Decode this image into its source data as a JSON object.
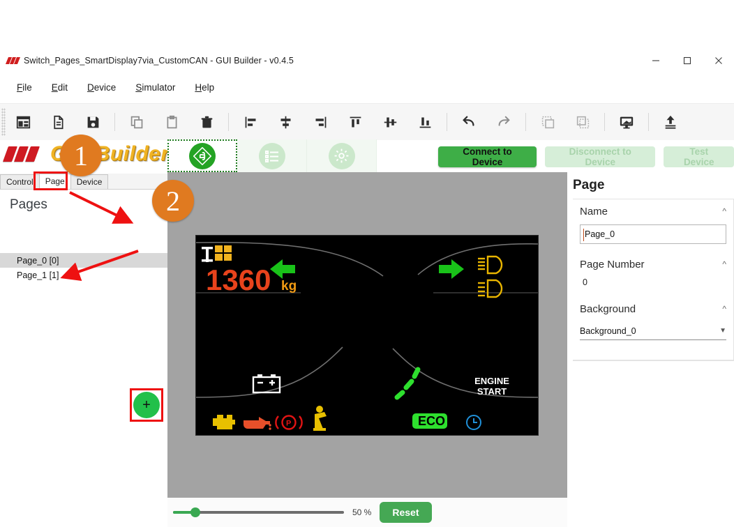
{
  "window": {
    "title": "Switch_Pages_SmartDisplay7via_CustomCAN - GUI Builder - v0.4.5",
    "minimize_label": "minimize",
    "maximize_label": "maximize",
    "close_label": "close"
  },
  "menubar": {
    "items": [
      {
        "label": "File",
        "accel": "F"
      },
      {
        "label": "Edit",
        "accel": "E"
      },
      {
        "label": "Device",
        "accel": "D"
      },
      {
        "label": "Simulator",
        "accel": "S"
      },
      {
        "label": "Help",
        "accel": "H"
      }
    ]
  },
  "toolbar": {
    "buttons": [
      {
        "name": "new-project-icon",
        "tooltip": "New Project"
      },
      {
        "name": "new-file-icon",
        "tooltip": "New File"
      },
      {
        "name": "save-icon",
        "tooltip": "Save"
      },
      {
        "name": "copy-icon",
        "tooltip": "Copy"
      },
      {
        "name": "paste-icon",
        "tooltip": "Paste"
      },
      {
        "name": "delete-icon",
        "tooltip": "Delete"
      },
      {
        "name": "align-left-icon",
        "tooltip": "Align Left"
      },
      {
        "name": "align-center-horizontal-icon",
        "tooltip": "Align Center"
      },
      {
        "name": "align-right-icon",
        "tooltip": "Align Right"
      },
      {
        "name": "align-top-icon",
        "tooltip": "Align Top"
      },
      {
        "name": "align-middle-vertical-icon",
        "tooltip": "Align Middle"
      },
      {
        "name": "align-bottom-icon",
        "tooltip": "Align Bottom"
      },
      {
        "name": "undo-icon",
        "tooltip": "Undo"
      },
      {
        "name": "redo-icon",
        "tooltip": "Redo"
      },
      {
        "name": "bring-to-front-icon",
        "tooltip": "Bring To Front"
      },
      {
        "name": "send-to-back-icon",
        "tooltip": "Send To Back"
      },
      {
        "name": "preview-screen-icon",
        "tooltip": "Preview"
      },
      {
        "name": "upload-icon",
        "tooltip": "Upload"
      }
    ]
  },
  "logo": {
    "text": "GUI Builder"
  },
  "view_tabs": [
    {
      "name": "tab-design",
      "icon": "flow-puzzle-icon",
      "active": true
    },
    {
      "name": "tab-list",
      "icon": "list-icon",
      "active": false
    },
    {
      "name": "tab-settings",
      "icon": "gear-icon",
      "active": false
    }
  ],
  "device_buttons": [
    {
      "label": "Connect to Device",
      "enabled": true
    },
    {
      "label": "Disconnect to Device",
      "enabled": false
    },
    {
      "label": "Test Device",
      "enabled": false
    }
  ],
  "left_panel": {
    "tabs": [
      {
        "label": "Control",
        "active": false
      },
      {
        "label": "Page",
        "active": true
      },
      {
        "label": "Device",
        "active": false
      }
    ],
    "heading": "Pages",
    "add_button_label": "+",
    "pages": [
      {
        "label": "Page_0 [0]",
        "selected": true
      },
      {
        "label": "Page_1 [1]",
        "selected": false
      }
    ]
  },
  "canvas": {
    "display": {
      "load_value": "1360",
      "load_unit": "kg",
      "eco_label": "ECO",
      "engine_start_line1": "ENGINE",
      "engine_start_line2": "START",
      "icons": [
        {
          "name": "pallet-load-icon",
          "color": "#f2b31f"
        },
        {
          "name": "arrow-left-icon",
          "color": "#19c219"
        },
        {
          "name": "arrow-right-icon",
          "color": "#19c219"
        },
        {
          "name": "low-beam-headlight-icon",
          "color": "#e8b400"
        },
        {
          "name": "high-beam-headlight-icon",
          "color": "#e8b400"
        },
        {
          "name": "battery-icon",
          "color": "#ffffff"
        },
        {
          "name": "check-engine-icon",
          "color": "#e8c000"
        },
        {
          "name": "oil-pressure-icon",
          "color": "#e8502a"
        },
        {
          "name": "parking-brake-icon",
          "color": "#e01414"
        },
        {
          "name": "seatbelt-icon",
          "color": "#e8c000"
        },
        {
          "name": "eco-badge-icon",
          "color": "#2ee02e"
        },
        {
          "name": "clock-icon",
          "color": "#2090d8"
        }
      ]
    }
  },
  "zoombar": {
    "zoom_level": "50 %",
    "zoom_percent": 50,
    "reset_label": "Reset"
  },
  "right_panel": {
    "title": "Page",
    "sections": [
      {
        "label": "Name",
        "value": "Page_0",
        "type": "input"
      },
      {
        "label": "Page Number",
        "value": "0",
        "type": "text"
      },
      {
        "label": "Background",
        "value": "Background_0",
        "type": "select"
      }
    ]
  },
  "annotations": {
    "badge_1": "1",
    "badge_2": "2",
    "highlight_color": "#ee1111",
    "badge_color": "#e07a20"
  }
}
